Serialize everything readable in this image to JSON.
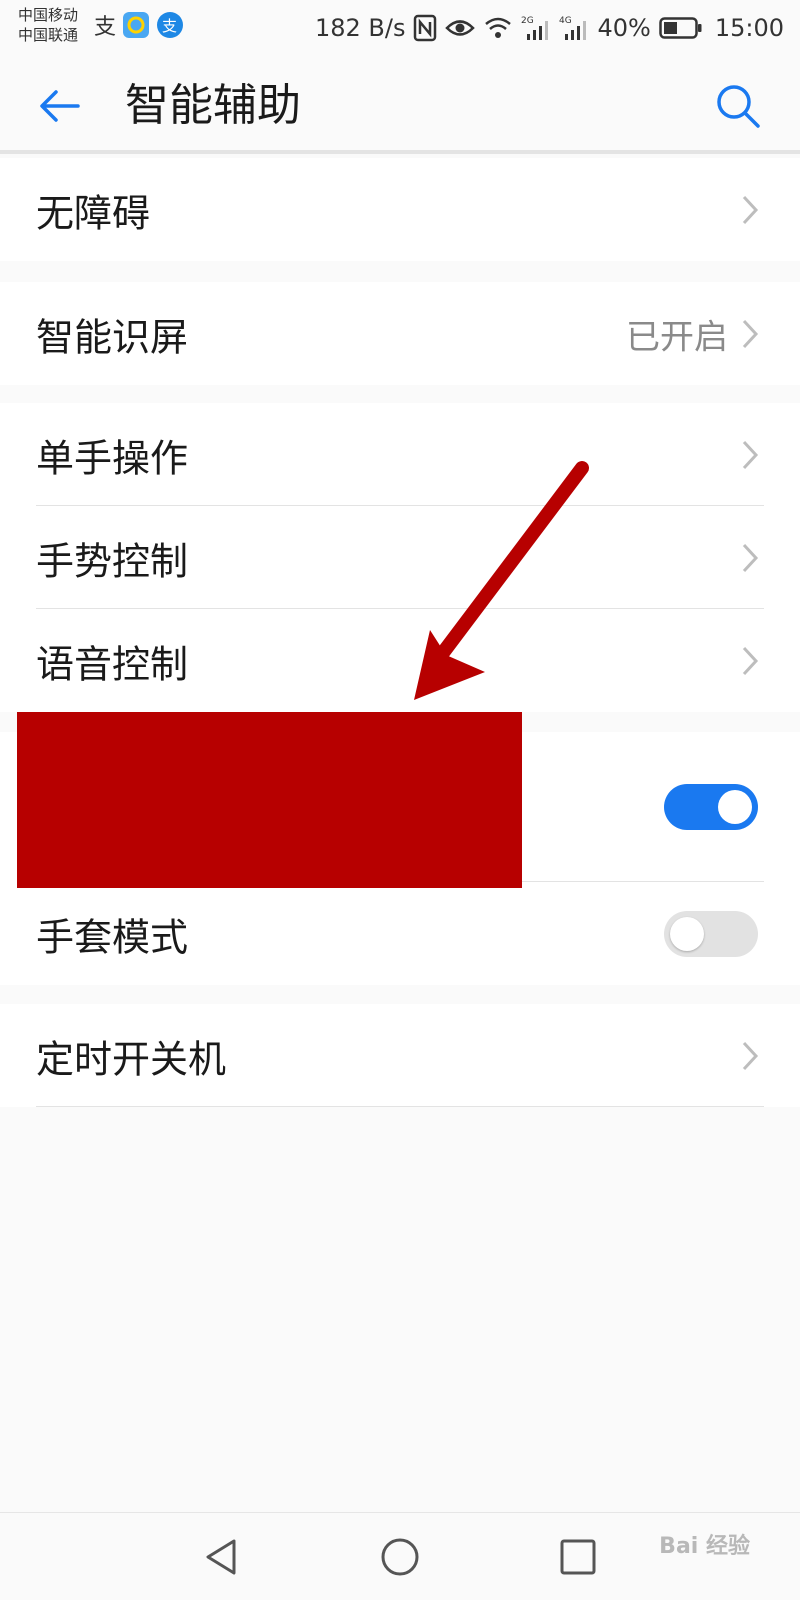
{
  "status_bar": {
    "carrier_1": "中国移动",
    "carrier_2": "中国联通",
    "speed": "182 B/s",
    "signal_1": "2G",
    "signal_2": "4G",
    "battery": "40%",
    "time": "15:00"
  },
  "app_bar": {
    "title": "智能辅助",
    "back_icon": "arrow-left",
    "search_icon": "magnifier"
  },
  "settings": {
    "accessibility": "无障碍",
    "smart_screen": "智能识屏",
    "smart_screen_value": "已开启",
    "one_hand": "单手操作",
    "gesture": "手势控制",
    "voice": "语音控制",
    "hidden_item_toggle": "on",
    "glove_mode": "手套模式",
    "glove_mode_toggle": "off",
    "timer_power": "定时开关机"
  },
  "annotation": {
    "redaction_color": "#b70000",
    "arrow_color": "#b70000"
  },
  "colors": {
    "accent": "#1a79f0",
    "background": "#f6f6f6"
  },
  "watermark": {
    "text": "Bai 经验"
  }
}
